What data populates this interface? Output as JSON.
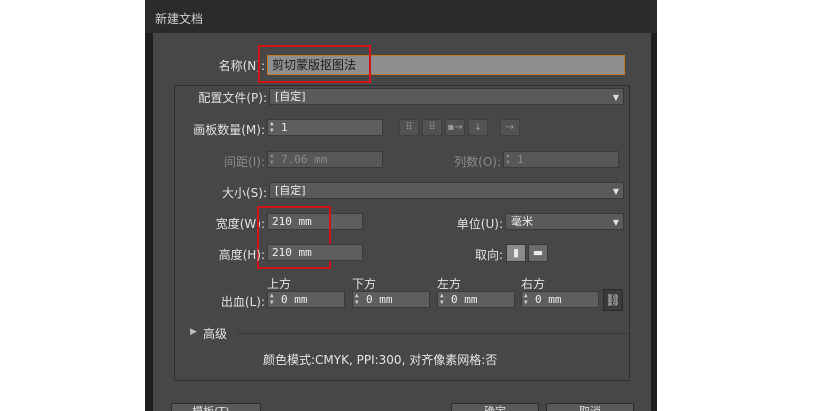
{
  "dialog": {
    "title": "新建文档"
  },
  "name": {
    "label": "名称(N):",
    "value": "剪切蒙版抠图法"
  },
  "profile": {
    "label": "配置文件(P):",
    "value": "[自定]"
  },
  "artboards": {
    "count_label": "画板数量(M):",
    "count_value": "1",
    "spacing_label": "间距(I):",
    "spacing_value": "7.06 mm",
    "columns_label": "列数(O):",
    "columns_value": "1",
    "layout_icons": [
      "grid-by-row-icon",
      "grid-by-column-icon",
      "arrange-by-row-icon",
      "arrange-by-column-icon",
      "right-to-left-icon"
    ]
  },
  "size": {
    "label": "大小(S):",
    "value": "[自定]"
  },
  "width": {
    "label": "宽度(W):",
    "value": "210 mm"
  },
  "height": {
    "label": "高度(H):",
    "value": "210 mm"
  },
  "units": {
    "label": "单位(U):",
    "value": "毫米"
  },
  "orientation": {
    "label": "取向:",
    "options": [
      "portrait-icon",
      "landscape-icon"
    ]
  },
  "bleed": {
    "label": "出血(L):",
    "top_label": "上方",
    "top_value": "0 mm",
    "bottom_label": "下方",
    "bottom_value": "0 mm",
    "left_label": "左方",
    "left_value": "0 mm",
    "right_label": "右方",
    "right_value": "0 mm"
  },
  "advanced": {
    "label": "高级"
  },
  "info": {
    "text": "颜色模式:CMYK, PPI:300, 对齐像素网格:否"
  },
  "footer": {
    "template_label": "模板(T)...",
    "ok_label": "确定",
    "cancel_label": "取消"
  },
  "colors": {
    "highlight": "#d0141b",
    "panel": "#474747",
    "frame": "#1e1e1e"
  }
}
